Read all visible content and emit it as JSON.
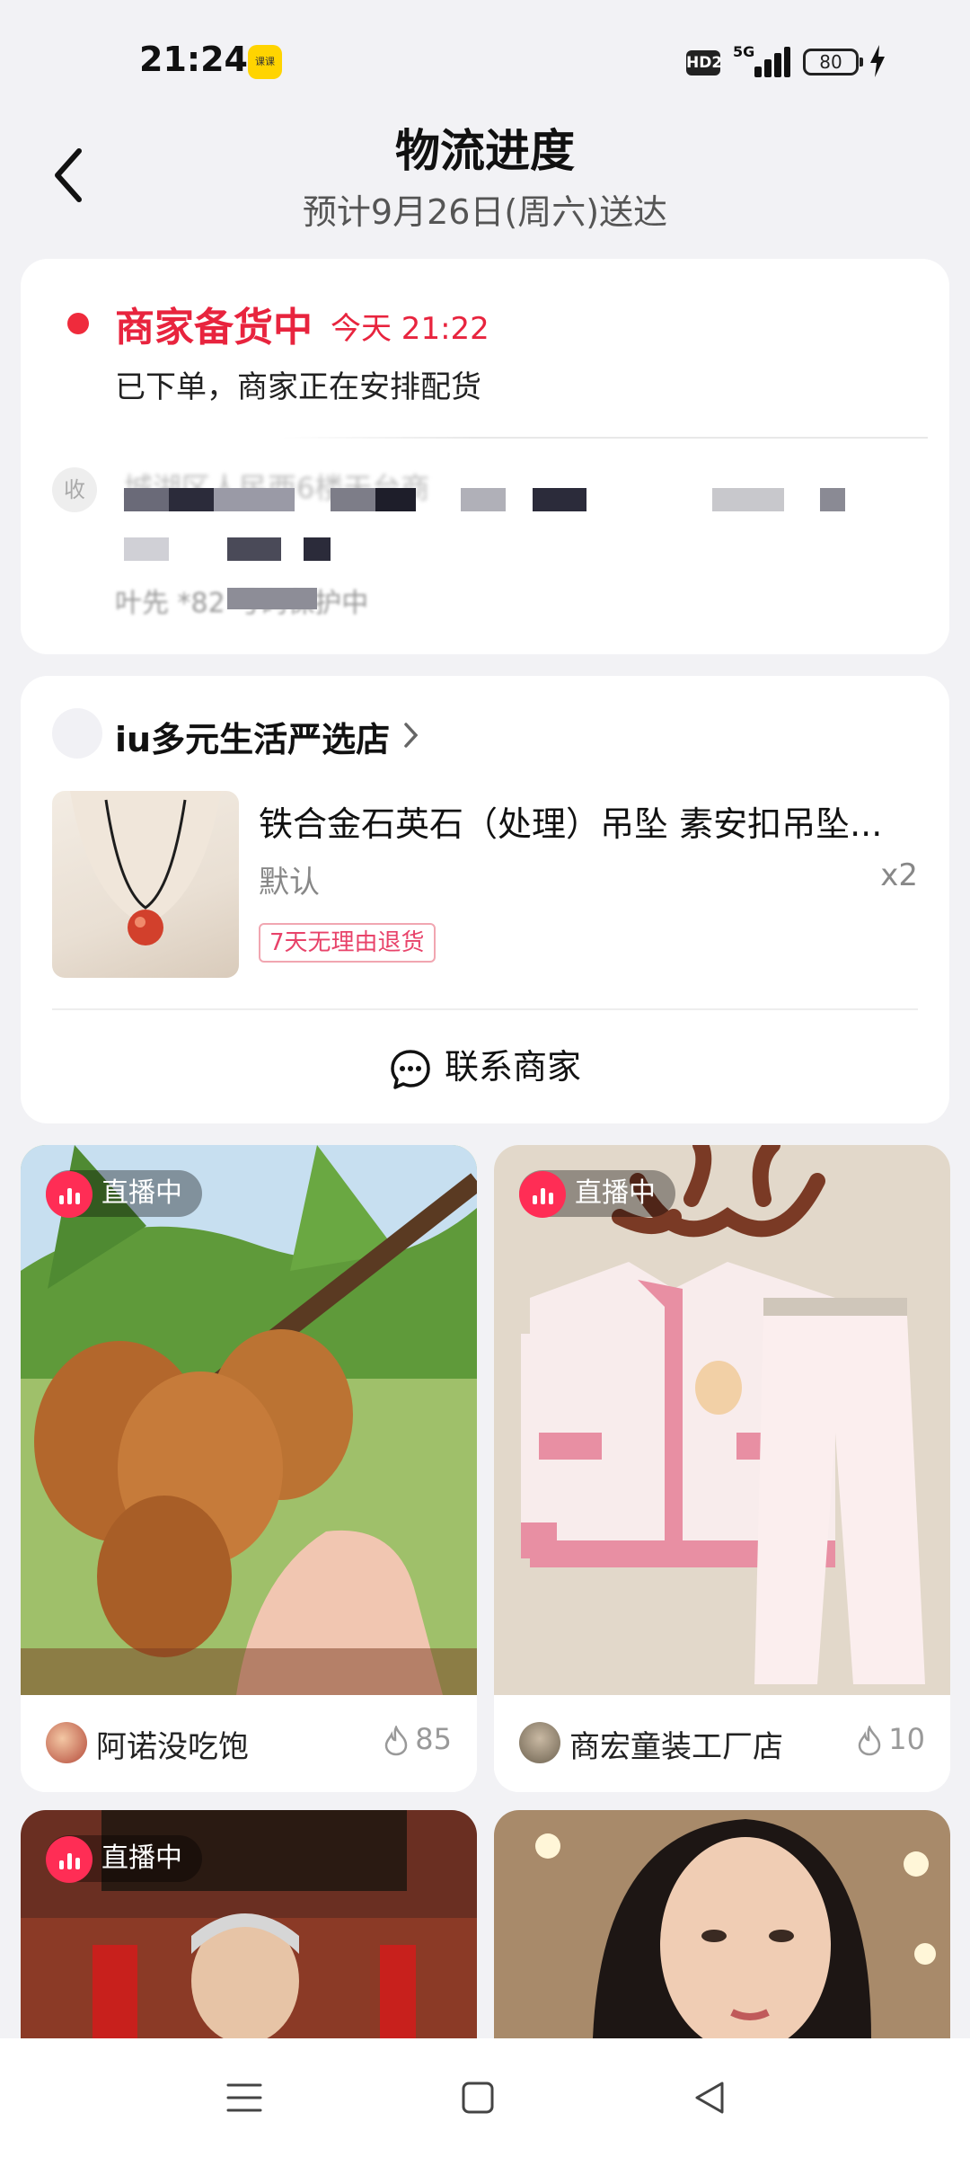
{
  "status_bar": {
    "time": "21:24",
    "app_icon_text": "课课",
    "hd_badge": "HD2",
    "network": "5G",
    "battery": "80"
  },
  "header": {
    "title": "物流进度",
    "subtitle": "预计9月26日(周六)送达"
  },
  "logistics": {
    "status": "商家备货中",
    "status_time": "今天 21:22",
    "description": "已下单，商家正在安排配货",
    "receiver_icon": "收",
    "address_visible": "城湖区人民西6楼天台商",
    "contact_visible": "叶先 *82 号码保护中"
  },
  "shop": {
    "name": "iu多元生活严选店",
    "product": {
      "title": "铁合金石英石（处理）吊坠 素安扣吊坠...",
      "spec": "默认",
      "quantity": "x2",
      "tag": "7天无理由退货"
    },
    "contact_button": "联系商家"
  },
  "feed": [
    {
      "live_label": "直播中",
      "author": "阿诺没吃饱",
      "heat": "85"
    },
    {
      "live_label": "直播中",
      "author": "商宏童装工厂店",
      "heat": "10"
    },
    {
      "live_label": "直播中",
      "author": "",
      "heat": ""
    },
    {
      "live_label": "",
      "author": "",
      "heat": ""
    }
  ],
  "colors": {
    "accent_red": "#e8243e",
    "live_pink": "#ff2d55",
    "background": "#f2f2f5"
  }
}
